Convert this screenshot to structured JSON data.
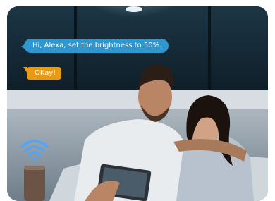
{
  "conversation": {
    "user_message": "Hi, Alexa, set the brightness to 50%.",
    "assistant_reply": "OKay!"
  },
  "colors": {
    "user_bubble": "#2f97cf",
    "assistant_bubble": "#e79a16",
    "wifi": "#4aa6ff"
  },
  "icons": {
    "signal": "wifi-icon",
    "device": "smart-speaker"
  }
}
